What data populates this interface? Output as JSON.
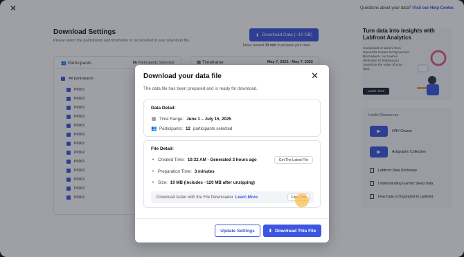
{
  "topbar": {
    "close_glyph": "✕",
    "help_text": "Questions about your data?",
    "help_link": "Visit our Help Center."
  },
  "page": {
    "title": "Download Settings",
    "subtitle": "Please select the participants and timeframe to be included in your download file.",
    "download_button": "Download Data (~10 GB)",
    "takes_prefix": "Takes around",
    "takes_bold": "30 min",
    "takes_suffix": "to prepare your data"
  },
  "participants": {
    "header": "Participants",
    "count": "56",
    "count_label": "Participants Selected",
    "all_label": "All participants",
    "items": [
      "P0001",
      "P0002",
      "P0001",
      "P0002",
      "P0001",
      "P0002",
      "P0001",
      "P0002",
      "P0001",
      "P0002",
      "P0001",
      "P0002",
      "P0001"
    ]
  },
  "timeframe": {
    "header": "Timeframe",
    "dates": "May 7, 2022 - May 7, 2022"
  },
  "promo": {
    "title": "Turn data into insights with Labfront Analytics",
    "text": "Comprised of alumni from Harvard's Center for Dynamical Biomarkers, our team is dedicated to helping you maximize the value of your data.",
    "button": "Learn more"
  },
  "resources": {
    "title": "Useful Resources",
    "items": [
      "HRV Course",
      "Actigraphy Collection",
      "Labfront Data Dictionary",
      "Understanding Garmin Sleep Data",
      "How Data is Organized in Labfront"
    ]
  },
  "modal": {
    "title": "Download your data file",
    "close_glyph": "✕",
    "subtitle": "The data file has been prepared and is ready for download.",
    "data_detail": {
      "heading": "Data Detail:",
      "time_range_label": "Time Range:",
      "time_range_value": "June 1 – July 15, 2025",
      "participants_label": "Participants:",
      "participants_value": "12",
      "participants_suffix": "participants selected"
    },
    "file_detail": {
      "heading": "File Detail:",
      "created_label": "Created Time:",
      "created_value": "10:32 AM - Generated 3 hours ago",
      "latest_button": "Get The Latest File",
      "prep_label": "Preparation Time:",
      "prep_value": "3 minutes",
      "size_label": "Size:",
      "size_value": "10 MB (includes ~120 MB after unzipping)",
      "faster_text": "Download faster with the File Downloader",
      "learn_more": "Learn More",
      "copy_button": "Copy Link"
    },
    "update_button": "Update Settings",
    "download_button": "Download This File"
  },
  "colors": {
    "accent": "#3d56e0",
    "overlay": "rgba(25,28,40,0.42)"
  }
}
